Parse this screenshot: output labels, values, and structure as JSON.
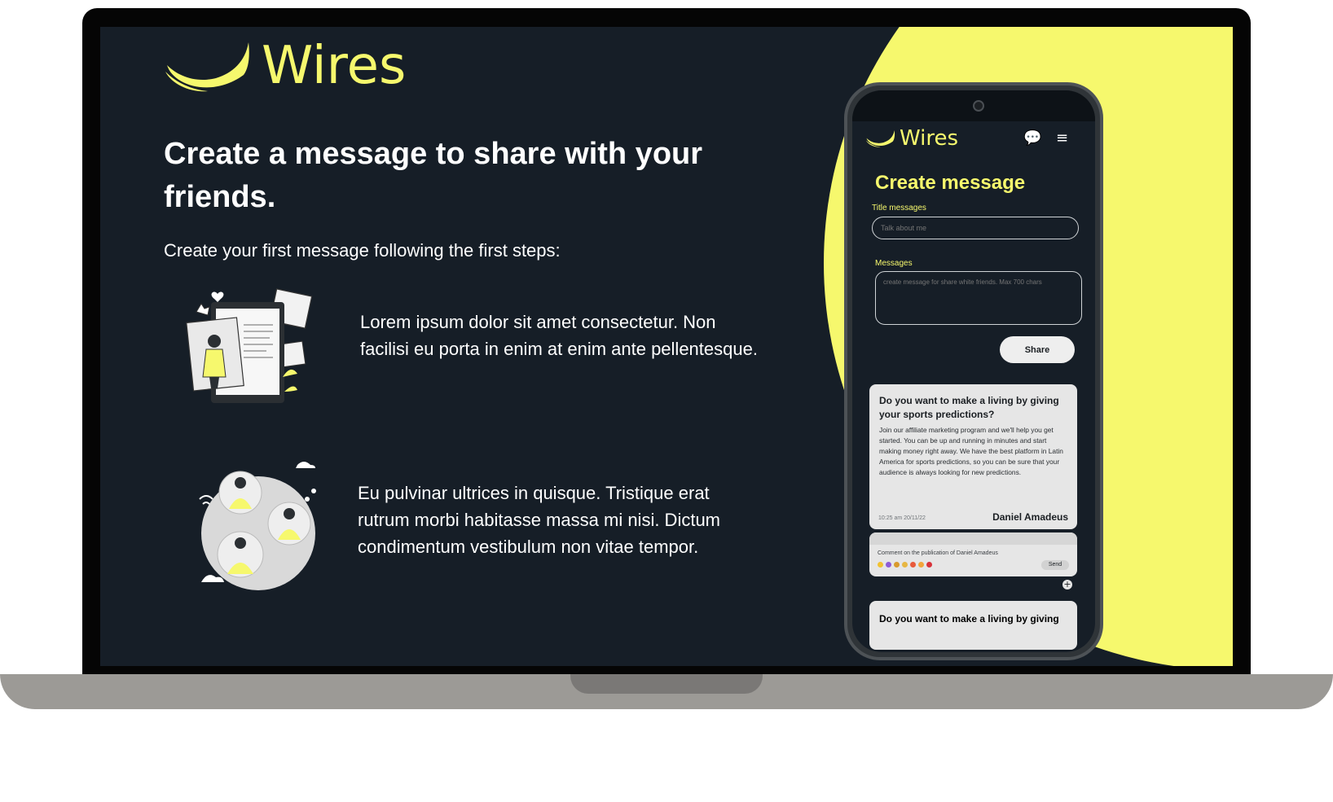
{
  "brand": {
    "name": "Wires",
    "accent_color": "#f6f86d",
    "background_color": "#161e27"
  },
  "landing": {
    "headline": "Create a message to share with your friends.",
    "intro": "Create your first message following the first steps:",
    "steps": [
      {
        "text": "Lorem ipsum dolor sit amet consectetur. Non facilisi eu porta in enim at enim ante pellentesque.",
        "illustration": "tablet-profile-illustration"
      },
      {
        "text": "Eu pulvinar ultrices in quisque. Tristique erat rutrum morbi habitasse massa mi nisi. Dictum condimentum vestibulum non vitae tempor.",
        "illustration": "globe-people-illustration"
      }
    ]
  },
  "app": {
    "logo_text": "Wires",
    "icons": {
      "chat": "chat-icon",
      "menu": "menu-icon"
    },
    "page_title": "Create message",
    "title_field": {
      "label": "Title messages",
      "placeholder": "Talk about me"
    },
    "message_field": {
      "label": "Messages",
      "placeholder": "create message for share white friends. Max 700 chars"
    },
    "share_label": "Share",
    "posts": [
      {
        "title": "Do you want to make a living by giving your sports predictions?",
        "body": "Join our affiliate marketing program and we'll help you get started. You can be up and running in minutes and start making money right away. We have the best platform in Latin America for sports predictions, so you can be sure that your audience is always looking for new predictions.",
        "time": "10:25 am 20/11/22",
        "author": "Daniel Amadeus"
      },
      {
        "title": "Do you want to make a living by giving"
      }
    ],
    "comment": {
      "placeholder": "Comment on the publication of Daniel Amadeus",
      "send_label": "Send",
      "emoji_colors": [
        "#f2c230",
        "#8e5bd6",
        "#d99a2c",
        "#e7b743",
        "#e85a3b",
        "#f2a53a",
        "#d8323a"
      ]
    }
  }
}
